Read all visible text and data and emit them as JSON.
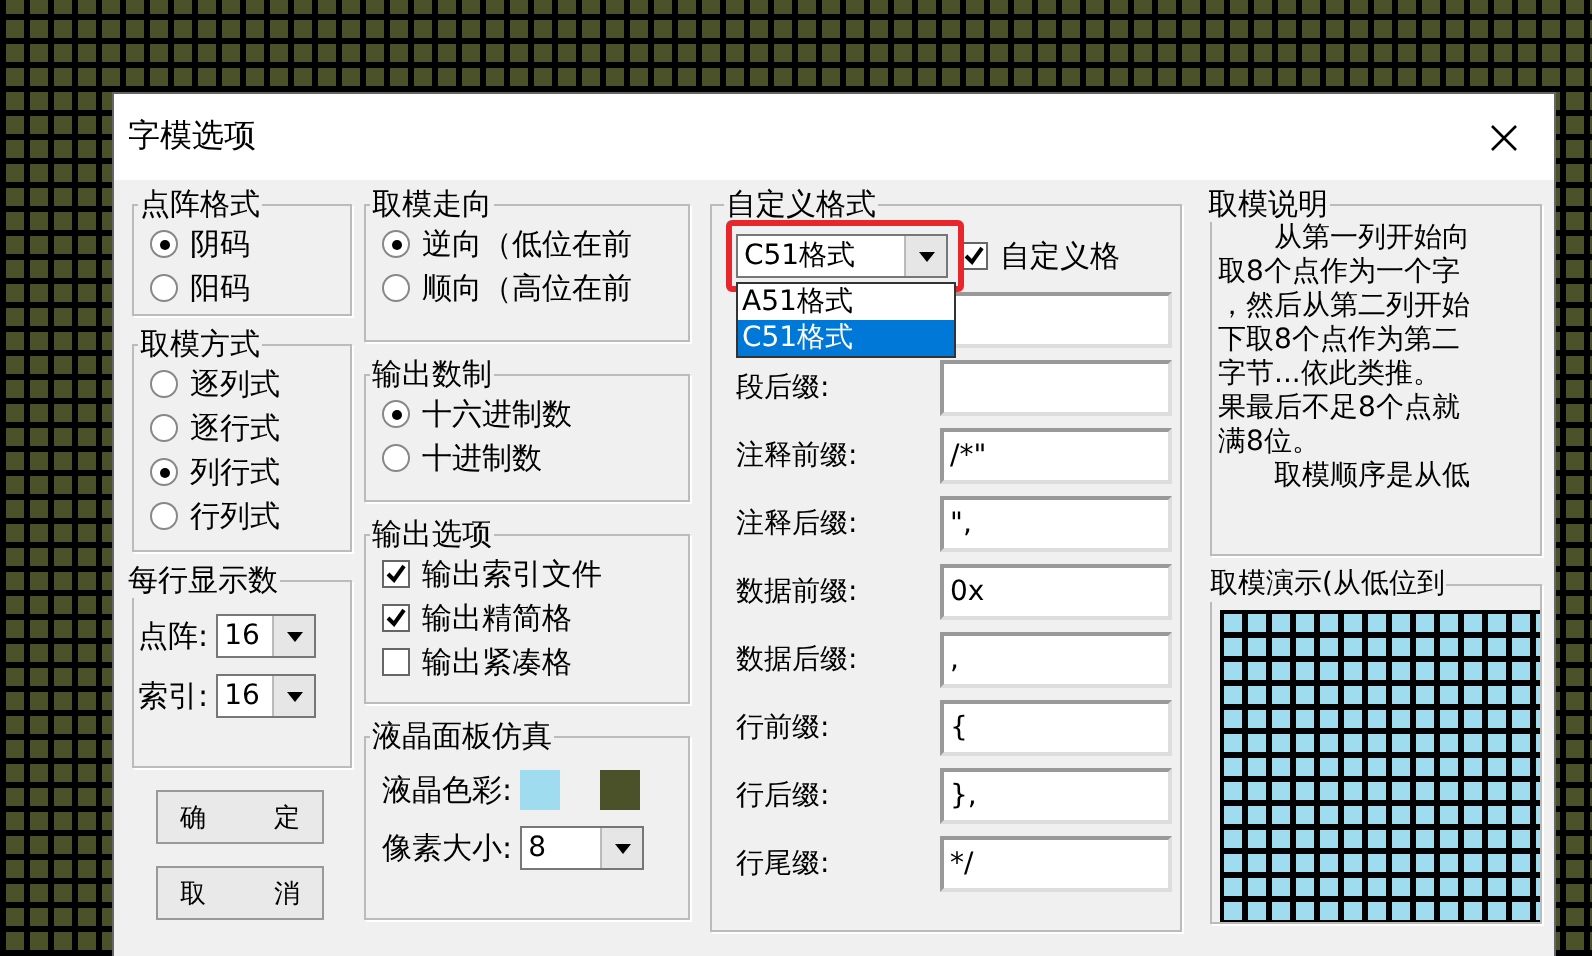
{
  "window": {
    "title": "字模选项"
  },
  "dot_format": {
    "title": "点阵格式",
    "options": [
      {
        "label": "阴码",
        "selected": true
      },
      {
        "label": "阳码",
        "selected": false
      }
    ]
  },
  "scan_mode": {
    "title": "取模方式",
    "options": [
      {
        "label": "逐列式",
        "selected": false
      },
      {
        "label": "逐行式",
        "selected": false
      },
      {
        "label": "列行式",
        "selected": true
      },
      {
        "label": "行列式",
        "selected": false
      }
    ]
  },
  "per_line": {
    "title": "每行显示数",
    "fields": [
      {
        "label": "点阵:",
        "value": "16"
      },
      {
        "label": "索引:",
        "value": "16"
      }
    ]
  },
  "buttons": [
    {
      "label": "确 定"
    },
    {
      "label": "取 消"
    }
  ],
  "direction": {
    "title": "取模走向",
    "options": [
      {
        "label": "逆向（低位在前",
        "selected": true
      },
      {
        "label": "顺向（高位在前",
        "selected": false
      }
    ]
  },
  "radix": {
    "title": "输出数制",
    "options": [
      {
        "label": "十六进制数",
        "selected": true
      },
      {
        "label": "十进制数",
        "selected": false
      }
    ]
  },
  "output": {
    "title": "输出选项",
    "options": [
      {
        "label": "输出索引文件",
        "checked": true
      },
      {
        "label": "输出精简格",
        "checked": true
      },
      {
        "label": "输出紧凑格",
        "checked": false
      }
    ]
  },
  "lcd": {
    "title": "液晶面板仿真",
    "color_label": "液晶色彩:",
    "colors": [
      {
        "color": "#9fdcef"
      },
      {
        "color": "#4b5229"
      }
    ],
    "pixel_label": "像素大小:",
    "pixel_value": "8"
  },
  "custom": {
    "title": "自定义格式",
    "format": "C51格式",
    "custom_check": {
      "label": "自定义格",
      "checked": true
    },
    "dropdown": [
      {
        "label": "A51格式",
        "selected": false
      },
      {
        "label": "C51格式",
        "selected": true
      }
    ],
    "covered_field": true,
    "fields": [
      {
        "label": "段后缀:"
      },
      {
        "label": "注释前缀:",
        "value": "/*\""
      },
      {
        "label": "注释后缀:",
        "value": "\","
      },
      {
        "label": "数据前缀:",
        "value": "0x"
      },
      {
        "label": "数据后缀:",
        "value": ","
      },
      {
        "label": "行前缀:",
        "value": "{"
      },
      {
        "label": "行后缀:",
        "value": "},"
      },
      {
        "label": "行尾缀:",
        "value": "*/"
      }
    ]
  },
  "description": {
    "title": "取模说明",
    "lines": [
      "从第一列开始向",
      "取8个点作为一个字",
      "，然后从第二列开始",
      "下取8个点作为第二",
      "字节...依此类推。",
      "果最后不足8个点就",
      "满8位。",
      "取模顺序是从低"
    ]
  },
  "demo": {
    "title": "取模演示(从低位到"
  }
}
